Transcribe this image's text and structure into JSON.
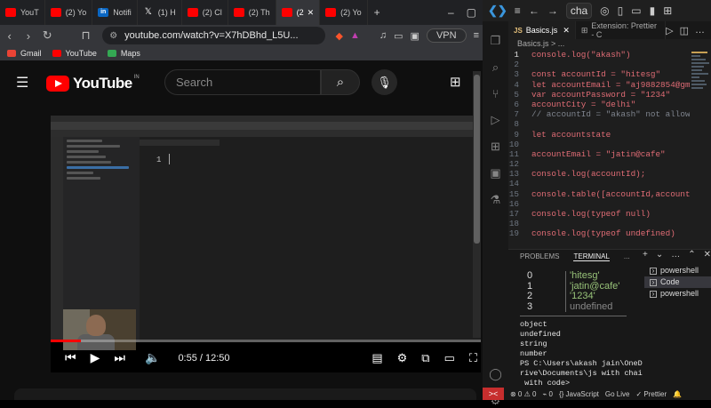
{
  "browser": {
    "tabs": [
      {
        "label": "YouT",
        "icon": "youtube-icon"
      },
      {
        "label": "(2) Yo",
        "icon": "youtube-icon"
      },
      {
        "label": "Notifi",
        "icon": "linkedin-icon"
      },
      {
        "label": "(1) H",
        "icon": "x-icon"
      },
      {
        "label": "(2) Cl",
        "icon": "youtube-icon"
      },
      {
        "label": "(2) Th",
        "icon": "youtube-icon"
      },
      {
        "label": "(2",
        "icon": "youtube-icon"
      },
      {
        "label": "(2) Yo",
        "icon": "youtube-icon"
      }
    ],
    "url": "youtube.com/watch?v=X7hDBhd_L5U...",
    "vpn_label": "VPN",
    "bookmarks": [
      {
        "label": "Gmail",
        "color": "#ea4335"
      },
      {
        "label": "YouTube",
        "color": "#ff0000"
      },
      {
        "label": "Maps",
        "color": "#34a853"
      }
    ]
  },
  "youtube": {
    "logo_text": "YouTube",
    "region": "IN",
    "search_placeholder": "Search",
    "player": {
      "time": "0:55 / 12:50",
      "progress": 0.071
    }
  },
  "vscode": {
    "title_search": "cha",
    "tabs": [
      {
        "label": "Basics.js",
        "active": true
      },
      {
        "label": "Extension: Prettier - C",
        "active": false
      }
    ],
    "breadcrumb": "Basics.js > ...",
    "code_lines": [
      {
        "n": "1",
        "text": "console.log(\"akash\")"
      },
      {
        "n": "2",
        "text": ""
      },
      {
        "n": "3",
        "text": "const accountId = \"hitesg\""
      },
      {
        "n": "4",
        "text": "let accountEmail = \"aj9882854@gma"
      },
      {
        "n": "5",
        "text": "var accountPassword = \"1234\""
      },
      {
        "n": "6",
        "text": "accountCity = \"delhi\""
      },
      {
        "n": "7",
        "text": "// accountId = \"akash\" not allowe"
      },
      {
        "n": "8",
        "text": ""
      },
      {
        "n": "9",
        "text": "let accountstate"
      },
      {
        "n": "10",
        "text": ""
      },
      {
        "n": "11",
        "text": "accountEmail = \"jatin@cafe\""
      },
      {
        "n": "12",
        "text": ""
      },
      {
        "n": "13",
        "text": "console.log(accountId);"
      },
      {
        "n": "14",
        "text": ""
      },
      {
        "n": "15",
        "text": "console.table([accountId,accountE"
      },
      {
        "n": "16",
        "text": ""
      },
      {
        "n": "17",
        "text": "console.log(typeof null)"
      },
      {
        "n": "18",
        "text": ""
      },
      {
        "n": "19",
        "text": "console.log(typeof undefined)"
      }
    ],
    "panel_tabs": [
      "PROBLEMS",
      "TERMINAL",
      "..."
    ],
    "terminal_table": [
      {
        "idx": "0",
        "val": "'hitesg'"
      },
      {
        "idx": "1",
        "val": "'jatin@cafe'"
      },
      {
        "idx": "2",
        "val": "'1234'"
      },
      {
        "idx": "3",
        "val": "undefined"
      }
    ],
    "terminal_output": [
      "object",
      "undefined",
      "string",
      "number",
      "PS C:\\Users\\akash jain\\OneD",
      "rive\\Documents\\js with chai",
      " with code>"
    ],
    "terminals": [
      {
        "label": "powershell",
        "active": false
      },
      {
        "label": "Code",
        "active": true
      },
      {
        "label": "powershell",
        "active": false
      }
    ],
    "status": {
      "remote": "><",
      "problems": "⊗ 0 ⚠ 0",
      "ports": "⌁ 0",
      "language": "{} JavaScript",
      "golive": "Go Live",
      "prettier": "✓ Prettier"
    }
  }
}
